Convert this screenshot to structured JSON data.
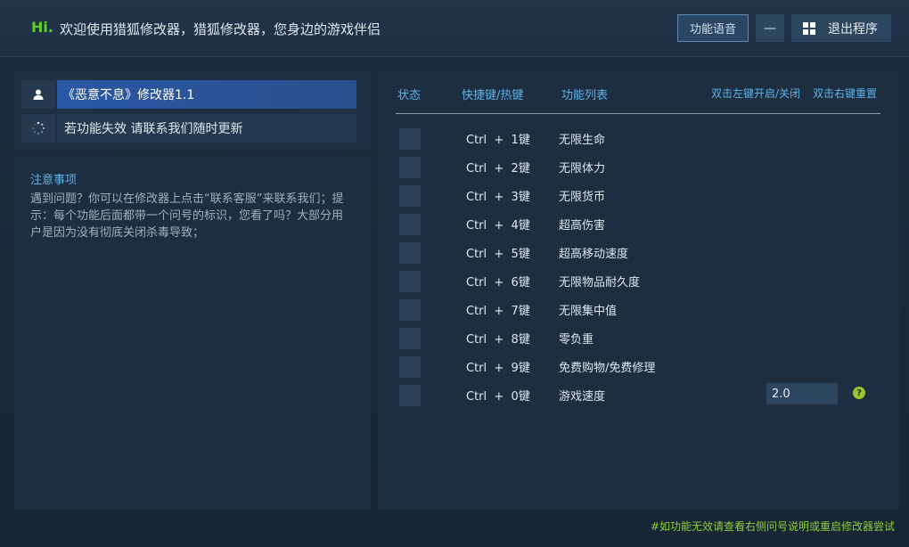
{
  "header": {
    "hi": "Hi.",
    "greeting": "欢迎使用猎狐修改器，猎狐修改器，您身边的游戏伴侣",
    "voice_button": "功能语音",
    "minimize_button": "—",
    "exit_button": "退出程序"
  },
  "game": {
    "title": "《恶意不息》修改器1.1",
    "update_text": "若功能失效  请联系我们随时更新"
  },
  "notes": {
    "title": "注意事项",
    "body": "遇到问题？你可以在修改器上点击“联系客服”来联系我们；提示：每个功能后面都带一个问号的标识，您看了吗？大部分用户是因为没有彻底关闭杀毒导致；"
  },
  "table": {
    "col_state": "状态",
    "col_hotkey": "快捷键/热键",
    "col_feature": "功能列表",
    "hint_left": "双击左键开启/关闭",
    "hint_right": "双击右键重置",
    "rows": [
      {
        "hotkey": "Ctrl  +  1键",
        "feature": "无限生命"
      },
      {
        "hotkey": "Ctrl  +  2键",
        "feature": "无限体力"
      },
      {
        "hotkey": "Ctrl  +  3键",
        "feature": "无限货币"
      },
      {
        "hotkey": "Ctrl  +  4键",
        "feature": "超高伤害"
      },
      {
        "hotkey": "Ctrl  +  5键",
        "feature": "超高移动速度"
      },
      {
        "hotkey": "Ctrl  +  6键",
        "feature": "无限物品耐久度"
      },
      {
        "hotkey": "Ctrl  +  7键",
        "feature": "无限集中值"
      },
      {
        "hotkey": "Ctrl  +  8键",
        "feature": "零负重"
      },
      {
        "hotkey": "Ctrl  +  9键",
        "feature": "免费购物/免费修理"
      },
      {
        "hotkey": "Ctrl  +  0键",
        "feature": "游戏速度",
        "input_value": "2.0",
        "help": "?"
      }
    ]
  },
  "footer": {
    "note": "#如功能无效请查看右侧问号说明或重启修改器尝试"
  },
  "icons": {
    "user": "user-icon",
    "loading": "loading-spinner-icon",
    "windows": "windows-logo-icon",
    "help": "help-icon"
  },
  "colors": {
    "accent_blue": "#5fb2e8",
    "hi_green": "#5bd12a",
    "selected_bar": "#2a57a4",
    "help_green": "#9ec52a"
  }
}
